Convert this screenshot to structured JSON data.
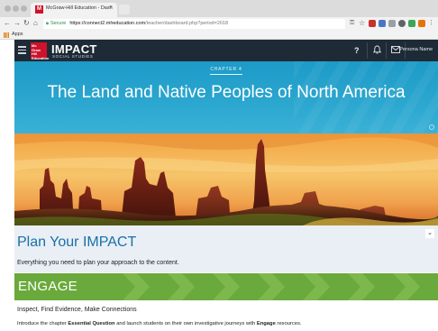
{
  "browser": {
    "tab_title": "McGraw-Hill Education - Dash",
    "tab_close": "×",
    "secure_label": "Secure",
    "url_host": "https://connect2.mheducation.com",
    "url_path": "/teacher/dashboard.php?period=2018",
    "bookmarks_apps": "Apps"
  },
  "header": {
    "logo_text": "Mc Graw Hill Education",
    "brand": "IMPACT",
    "brand_sub": "SOCIAL STUDIES",
    "help_icon": "?",
    "user_name": "Persona Name"
  },
  "hero": {
    "chapter": "CHAPTER 4",
    "title": "The Land and Native Peoples of North America"
  },
  "plan": {
    "title": "Plan Your IMPACT",
    "subtitle": "Everything you need to plan your approach to the content."
  },
  "engage": {
    "title": "ENGAGE",
    "heading": "Inspect, Find Evidence, Make Connections",
    "body_1": "Introduce the chapter ",
    "body_bold_1": "Essential Question",
    "body_2": " and launch students on their own investigative journeys with ",
    "body_bold_2": "Engage",
    "body_3": " resources."
  },
  "colors": {
    "header_bg": "#1e2a36",
    "hero_blue": "#1d9ac7",
    "plan_blue": "#1a6fa8",
    "engage_green": "#6aaa3c",
    "brand_red": "#d0112b"
  }
}
